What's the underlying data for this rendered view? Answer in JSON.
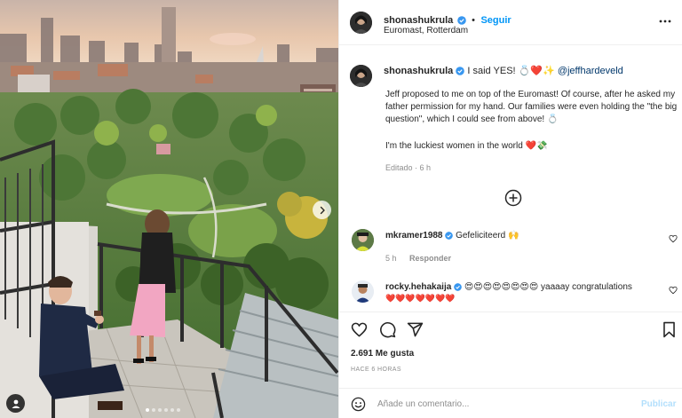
{
  "photo": {
    "alt": "",
    "nav_next_icon": "chevron-right-icon",
    "slides_total": 6,
    "slide_active": 1,
    "tag_icon": "user-tag-icon"
  },
  "header": {
    "username": "shonashukrula",
    "verified": true,
    "separator": "•",
    "follow_label": "Seguir",
    "location": "Euromast, Rotterdam",
    "more_icon": "more-horizontal-icon"
  },
  "caption": {
    "username": "shonashukrula",
    "intro": "I said YES! 💍❤️✨",
    "mention": "@jeffhardeveld",
    "paragraph": "Jeff proposed to me on top of the Euromast! Of course, after he asked my father permission for my hand. Our families were even holding the \"the big question\", which I could see from above! 💍",
    "closing": "I'm the luckiest women in the world ❤️💸",
    "edited_label": "Editado",
    "time": "6 h"
  },
  "load_more_icon": "plus-circle-icon",
  "comments": [
    {
      "username": "mkramer1988",
      "verified": true,
      "text": "Gefeliciteerd 🙌",
      "time": "5 h",
      "reply_label": "Responder"
    },
    {
      "username": "rocky.hehakaija",
      "verified": true,
      "text": "😍😍😍😍😍😍😍😍 yaaaay congratulations",
      "hearts": "❤️❤️❤️❤️❤️❤️❤️"
    }
  ],
  "actions": {
    "like_icon": "heart-icon",
    "comment_icon": "comment-icon",
    "share_icon": "send-icon",
    "save_icon": "bookmark-icon"
  },
  "likes": "2.691 Me gusta",
  "posted_ago": "HACE 6 HORAS",
  "add_comment": {
    "emoji_icon": "emoji-icon",
    "placeholder": "Añade un comentario...",
    "publish_label": "Publicar"
  },
  "colors": {
    "link_blue": "#0095f6",
    "mention_blue": "#00376b",
    "muted": "#8e8e8e",
    "publish_disabled": "#b2dffc",
    "verified_blue": "#3897f0",
    "heart_red": "#d62839"
  }
}
